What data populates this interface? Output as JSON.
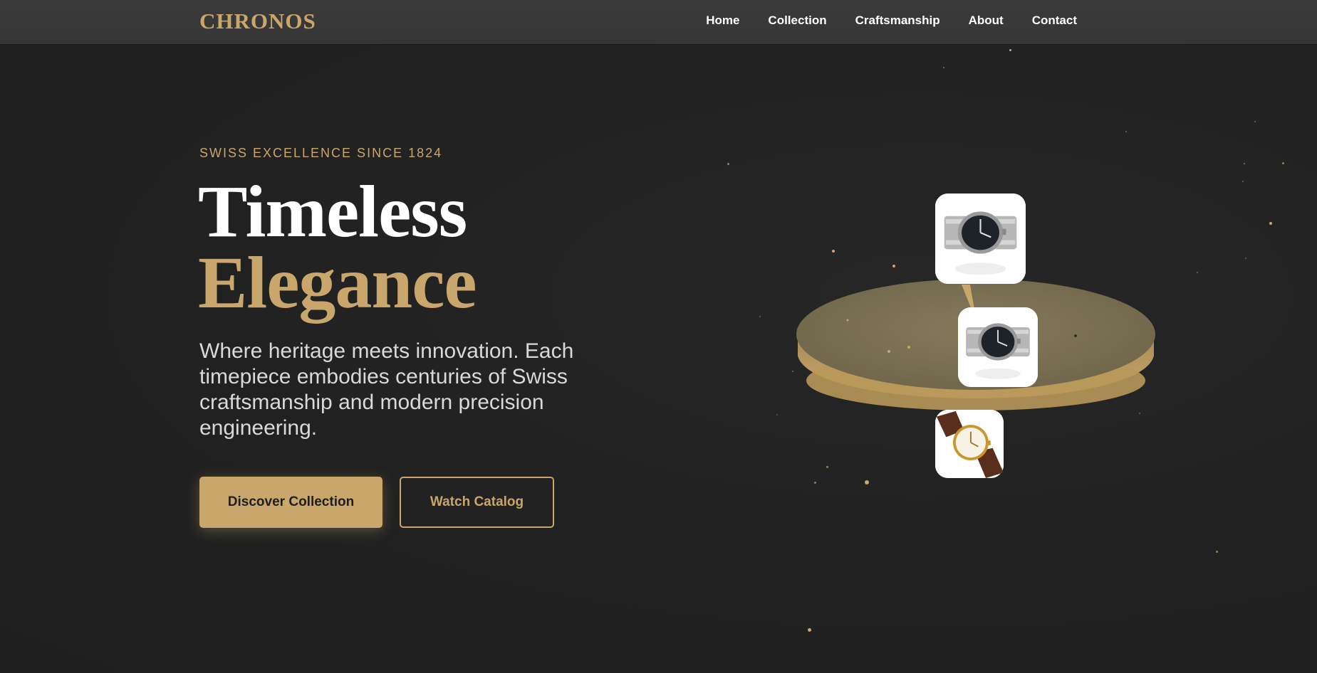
{
  "brand": {
    "name": "CHRONOS"
  },
  "nav": {
    "links": [
      "Home",
      "Collection",
      "Craftsmanship",
      "About",
      "Contact"
    ]
  },
  "hero": {
    "eyebrow": "SWISS EXCELLENCE SINCE 1824",
    "title_line1": "Timeless",
    "title_line2": "Elegance",
    "subtitle": "Where heritage meets innovation. Each timepiece embodies centuries of Swiss craftsmanship and modern precision engineering.",
    "primary_button": "Discover Collection",
    "secondary_button": "Watch Catalog"
  },
  "showcase": {
    "cards": [
      {
        "watch": "steel-dive-watch-icon"
      },
      {
        "watch": "steel-dive-watch-icon"
      },
      {
        "watch": "gold-leather-dress-watch-icon"
      }
    ]
  },
  "colors": {
    "accent": "#c9a66b",
    "background": "#222222",
    "navbar": "#383838",
    "platform_top": "#7b7051",
    "platform_side": "#b99a5f"
  }
}
